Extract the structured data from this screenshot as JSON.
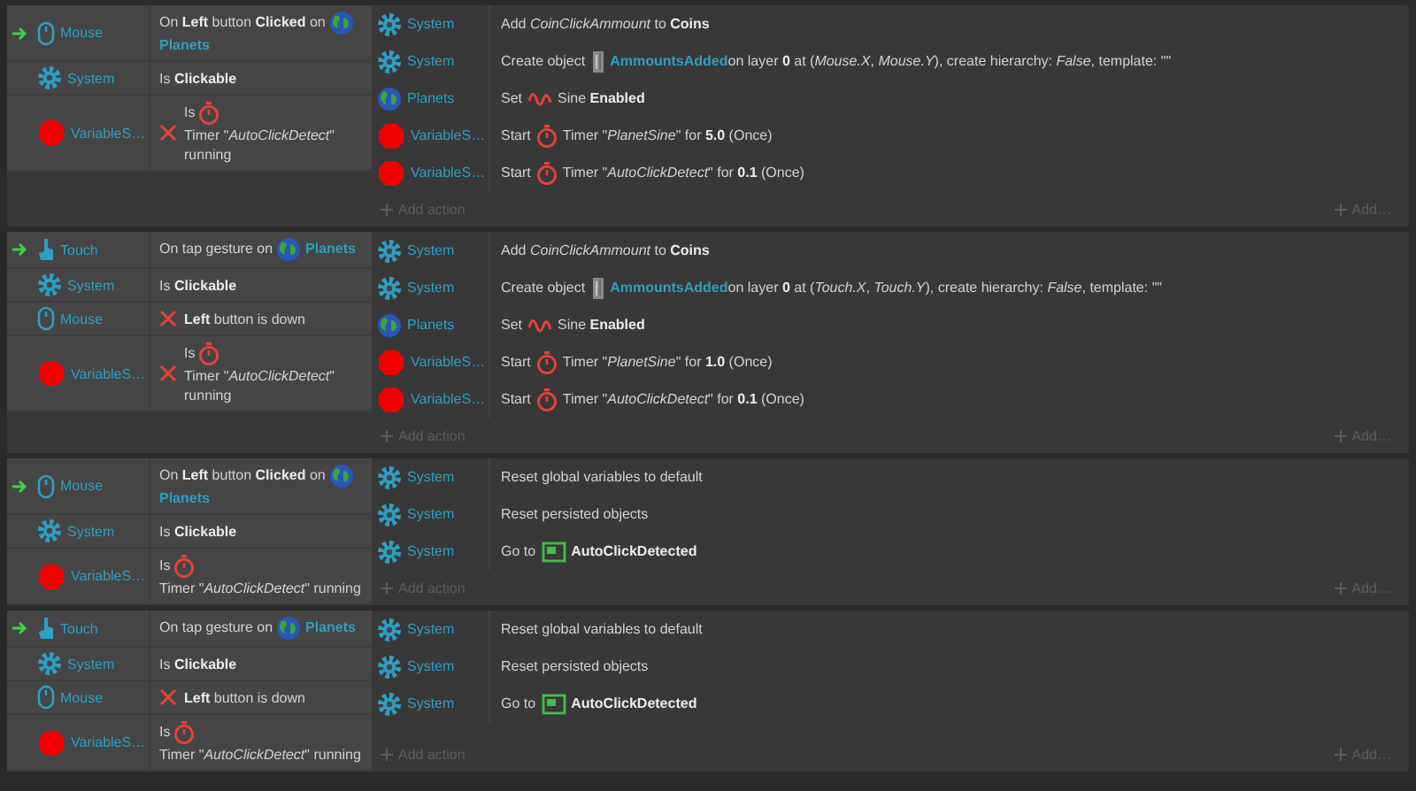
{
  "events": [
    {
      "conditions": [
        {
          "kind": "mouse",
          "object": "Mouse",
          "trigger": true,
          "inverted": false,
          "parts": [
            {
              "kind": "text",
              "text": "On **Left** button **Clicked** on"
            },
            {
              "kind": "globe"
            },
            {
              "kind": "link",
              "text": "Planets"
            }
          ]
        },
        {
          "kind": "system",
          "object": "System",
          "trigger": false,
          "inverted": false,
          "parts": [
            {
              "kind": "text",
              "text": "Is **Clickable**"
            }
          ]
        },
        {
          "kind": "variable",
          "object": "VariableS…",
          "trigger": false,
          "inverted": true,
          "parts": [
            {
              "kind": "text",
              "text": "Is"
            },
            {
              "kind": "timer"
            },
            {
              "kind": "text",
              "text": "Timer \"*AutoClickDetect*\" running"
            }
          ]
        }
      ],
      "actions": [
        {
          "kind": "system",
          "object": "System",
          "parts": [
            {
              "kind": "text",
              "text": "Add *CoinClickAmmount* to **Coins**"
            }
          ]
        },
        {
          "kind": "system",
          "object": "System",
          "parts": [
            {
              "kind": "text",
              "text": "Create object"
            },
            {
              "kind": "sprite"
            },
            {
              "kind": "link",
              "text": "AmmountsAdded"
            },
            {
              "kind": "text",
              "text": "on layer **0** at (*Mouse.X*, *Mouse.Y*), create hierarchy: *False*, template: \"\""
            }
          ]
        },
        {
          "kind": "planets",
          "object": "Planets",
          "parts": [
            {
              "kind": "text",
              "text": "Set"
            },
            {
              "kind": "sine"
            },
            {
              "kind": "text",
              "text": "Sine **Enabled**"
            }
          ]
        },
        {
          "kind": "variable",
          "object": "VariableS…",
          "parts": [
            {
              "kind": "text",
              "text": "Start"
            },
            {
              "kind": "timer"
            },
            {
              "kind": "text",
              "text": "Timer \"*PlanetSine*\" for **5.0** (Once)"
            }
          ]
        },
        {
          "kind": "variable",
          "object": "VariableS…",
          "parts": [
            {
              "kind": "text",
              "text": "Start"
            },
            {
              "kind": "timer"
            },
            {
              "kind": "text",
              "text": "Timer \"*AutoClickDetect*\" for **0.1** (Once)"
            }
          ]
        }
      ],
      "add_action": "Add action",
      "add": "Add…"
    },
    {
      "conditions": [
        {
          "kind": "touch",
          "object": "Touch",
          "trigger": true,
          "inverted": false,
          "parts": [
            {
              "kind": "text",
              "text": "On tap gesture on"
            },
            {
              "kind": "globe"
            },
            {
              "kind": "link",
              "text": "Planets"
            }
          ]
        },
        {
          "kind": "system",
          "object": "System",
          "trigger": false,
          "inverted": false,
          "parts": [
            {
              "kind": "text",
              "text": "Is **Clickable**"
            }
          ]
        },
        {
          "kind": "mouse",
          "object": "Mouse",
          "trigger": false,
          "inverted": true,
          "parts": [
            {
              "kind": "text",
              "text": "**Left** button is down"
            }
          ]
        },
        {
          "kind": "variable",
          "object": "VariableS…",
          "trigger": false,
          "inverted": true,
          "parts": [
            {
              "kind": "text",
              "text": "Is"
            },
            {
              "kind": "timer"
            },
            {
              "kind": "text",
              "text": "Timer \"*AutoClickDetect*\" running"
            }
          ]
        }
      ],
      "actions": [
        {
          "kind": "system",
          "object": "System",
          "parts": [
            {
              "kind": "text",
              "text": "Add *CoinClickAmmount* to **Coins**"
            }
          ]
        },
        {
          "kind": "system",
          "object": "System",
          "parts": [
            {
              "kind": "text",
              "text": "Create object"
            },
            {
              "kind": "sprite"
            },
            {
              "kind": "link",
              "text": "AmmountsAdded"
            },
            {
              "kind": "text",
              "text": "on layer **0** at (*Touch.X*, *Touch.Y*), create hierarchy: *False*, template: \"\""
            }
          ]
        },
        {
          "kind": "planets",
          "object": "Planets",
          "parts": [
            {
              "kind": "text",
              "text": "Set"
            },
            {
              "kind": "sine"
            },
            {
              "kind": "text",
              "text": "Sine **Enabled**"
            }
          ]
        },
        {
          "kind": "variable",
          "object": "VariableS…",
          "parts": [
            {
              "kind": "text",
              "text": "Start"
            },
            {
              "kind": "timer"
            },
            {
              "kind": "text",
              "text": "Timer \"*PlanetSine*\" for **1.0** (Once)"
            }
          ]
        },
        {
          "kind": "variable",
          "object": "VariableS…",
          "parts": [
            {
              "kind": "text",
              "text": "Start"
            },
            {
              "kind": "timer"
            },
            {
              "kind": "text",
              "text": "Timer \"*AutoClickDetect*\" for **0.1** (Once)"
            }
          ]
        }
      ],
      "add_action": "Add action",
      "add": "Add…"
    },
    {
      "conditions": [
        {
          "kind": "mouse",
          "object": "Mouse",
          "trigger": true,
          "inverted": false,
          "parts": [
            {
              "kind": "text",
              "text": "On **Left** button **Clicked** on"
            },
            {
              "kind": "globe"
            },
            {
              "kind": "link",
              "text": "Planets"
            }
          ]
        },
        {
          "kind": "system",
          "object": "System",
          "trigger": false,
          "inverted": false,
          "parts": [
            {
              "kind": "text",
              "text": "Is **Clickable**"
            }
          ]
        },
        {
          "kind": "variable",
          "object": "VariableS…",
          "trigger": false,
          "inverted": false,
          "parts": [
            {
              "kind": "text",
              "text": "Is"
            },
            {
              "kind": "timer"
            },
            {
              "kind": "text",
              "text": "Timer \"*AutoClickDetect*\" running"
            }
          ]
        }
      ],
      "actions": [
        {
          "kind": "system",
          "object": "System",
          "parts": [
            {
              "kind": "text",
              "text": "Reset global variables to default"
            }
          ]
        },
        {
          "kind": "system",
          "object": "System",
          "parts": [
            {
              "kind": "text",
              "text": "Reset persisted objects"
            }
          ]
        },
        {
          "kind": "system",
          "object": "System",
          "parts": [
            {
              "kind": "text",
              "text": "Go to"
            },
            {
              "kind": "layout"
            },
            {
              "kind": "text",
              "text": "**AutoClickDetected**"
            }
          ]
        }
      ],
      "add_action": "Add action",
      "add": "Add…"
    },
    {
      "conditions": [
        {
          "kind": "touch",
          "object": "Touch",
          "trigger": true,
          "inverted": false,
          "parts": [
            {
              "kind": "text",
              "text": "On tap gesture on"
            },
            {
              "kind": "globe"
            },
            {
              "kind": "link",
              "text": "Planets"
            }
          ]
        },
        {
          "kind": "system",
          "object": "System",
          "trigger": false,
          "inverted": false,
          "parts": [
            {
              "kind": "text",
              "text": "Is **Clickable**"
            }
          ]
        },
        {
          "kind": "mouse",
          "object": "Mouse",
          "trigger": false,
          "inverted": true,
          "parts": [
            {
              "kind": "text",
              "text": "**Left** button is down"
            }
          ]
        },
        {
          "kind": "variable",
          "object": "VariableS…",
          "trigger": false,
          "inverted": false,
          "parts": [
            {
              "kind": "text",
              "text": "Is"
            },
            {
              "kind": "timer"
            },
            {
              "kind": "text",
              "text": "Timer \"*AutoClickDetect*\" running"
            }
          ]
        }
      ],
      "actions": [
        {
          "kind": "system",
          "object": "System",
          "parts": [
            {
              "kind": "text",
              "text": "Reset global variables to default"
            }
          ]
        },
        {
          "kind": "system",
          "object": "System",
          "parts": [
            {
              "kind": "text",
              "text": "Reset persisted objects"
            }
          ]
        },
        {
          "kind": "system",
          "object": "System",
          "parts": [
            {
              "kind": "text",
              "text": "Go to"
            },
            {
              "kind": "layout"
            },
            {
              "kind": "text",
              "text": "**AutoClickDetected**"
            }
          ]
        }
      ],
      "add_action": "Add action",
      "add": "Add…"
    }
  ]
}
